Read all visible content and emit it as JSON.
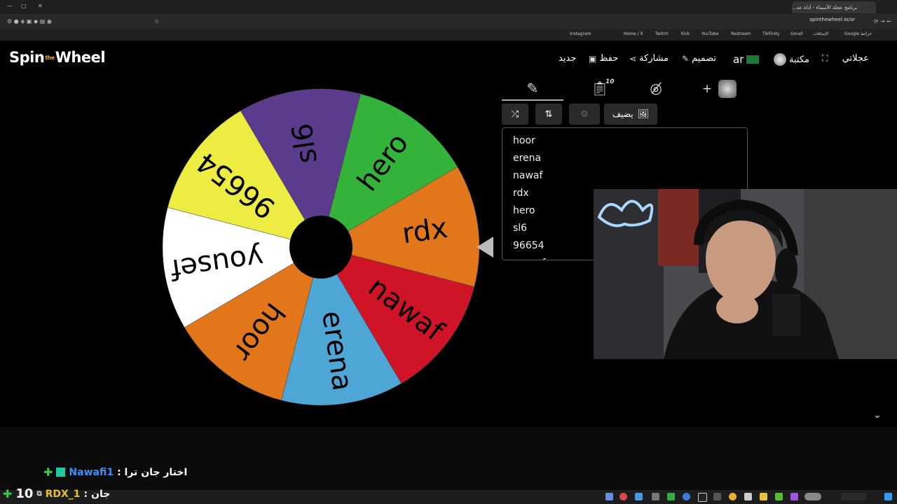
{
  "browser": {
    "tab_title": "برنامج عجلة الأسماء - أداة عد...",
    "url": "spinthewheel.io/ar",
    "bookmarks": [
      "Instagram",
      "Home / X",
      "Twitch",
      "Kick",
      "YouTube",
      "Restream",
      "TikFinity",
      "Gmail",
      "الإضافات",
      "Google خرائط"
    ]
  },
  "app": {
    "logo_left": "Spin",
    "logo_the": "the",
    "logo_right": "Wheel",
    "nav": {
      "my_wheels": "عجلاتي",
      "library": "مكتبة",
      "language": "ar",
      "design": "تصميم",
      "share": "مشاركة",
      "save": "حفظ",
      "new": "جديد"
    },
    "toolbar": {
      "entries_count": "10",
      "add_image": "يضيف"
    },
    "entries": [
      "hoor",
      "erena",
      "nawaf",
      "rdx",
      "hero",
      "sl6",
      "96654",
      "yousef"
    ],
    "wheel_segments": [
      {
        "label": "rdx",
        "color": "#e1761a"
      },
      {
        "label": "nawaf",
        "color": "#cf1428"
      },
      {
        "label": "erena",
        "color": "#4ea6d6"
      },
      {
        "label": "hoor",
        "color": "#e1761a"
      },
      {
        "label": "yousef",
        "color": "#ffffff"
      },
      {
        "label": "96654",
        "color": "#ecec42"
      },
      {
        "label": "sl6",
        "color": "#5b3b8c"
      },
      {
        "label": "hero",
        "color": "#33b33a"
      }
    ]
  },
  "chat": {
    "line1_user": "Nawafi1",
    "line1_text": "اختار جان ترا :",
    "line2_user": "RDX_1",
    "line2_text": "جان :",
    "viewer_count": "10"
  },
  "colors": {
    "accent_nav_icon": "#dddddd",
    "chat_user1": "#3e8ef7",
    "chat_user2": "#e8c030",
    "background": "#000000"
  }
}
